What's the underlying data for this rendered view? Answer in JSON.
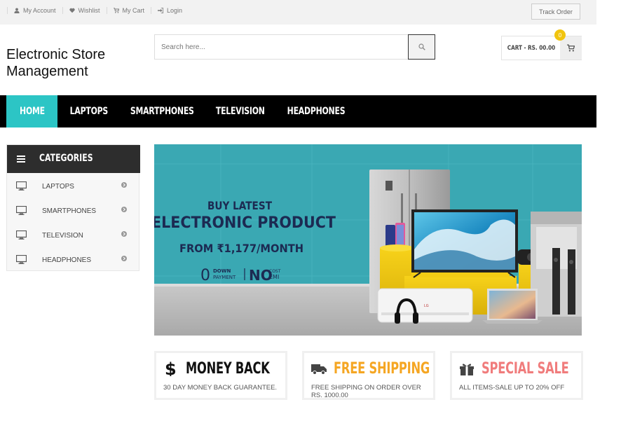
{
  "topbar": {
    "links": [
      "My Account",
      "Wishlist",
      "My Cart",
      "Login"
    ],
    "track_order": "Track Order"
  },
  "header": {
    "brand_line1": "Electronic Store",
    "brand_line2": "Management",
    "search_placeholder": "Search here...",
    "cart_label": "CART - RS. 00.00",
    "cart_count": "0"
  },
  "nav": {
    "items": [
      "HOME",
      "LAPTOPS",
      "SMARTPHONES",
      "TELEVISION",
      "HEADPHONES"
    ],
    "active": "HOME"
  },
  "categories": {
    "title": "CATEGORIES",
    "items": [
      "LAPTOPS",
      "SMARTPHONES",
      "TELEVISION",
      "HEADPHONES"
    ]
  },
  "banner": {
    "line1": "BUY LATEST",
    "line2": "ELECTRONIC PRODUCT",
    "line3": "FROM ₹1,177/MONTH",
    "down_zero": "0",
    "down_a": "DOWN",
    "down_b": "PAYMENT",
    "no": "NO",
    "cost_a": "COST",
    "cost_b": "EMI"
  },
  "features": [
    {
      "title": "MONEY BACK",
      "desc": "30 DAY MONEY BACK GUARANTEE.",
      "color": "#111111",
      "icon": "dollar-icon"
    },
    {
      "title": "FREE SHIPPING",
      "desc": "FREE SHIPPING ON ORDER OVER RS. 1000.00",
      "color": "#f5a623",
      "icon": "truck-icon"
    },
    {
      "title": "SPECIAL SALE",
      "desc": "ALL ITEMS-SALE UP TO 20% OFF",
      "color": "#f07c7c",
      "icon": "gift-icon"
    }
  ],
  "colors": {
    "accent": "#2cc5c5",
    "nav_bg": "#000000",
    "badge": "#f1c40f"
  }
}
